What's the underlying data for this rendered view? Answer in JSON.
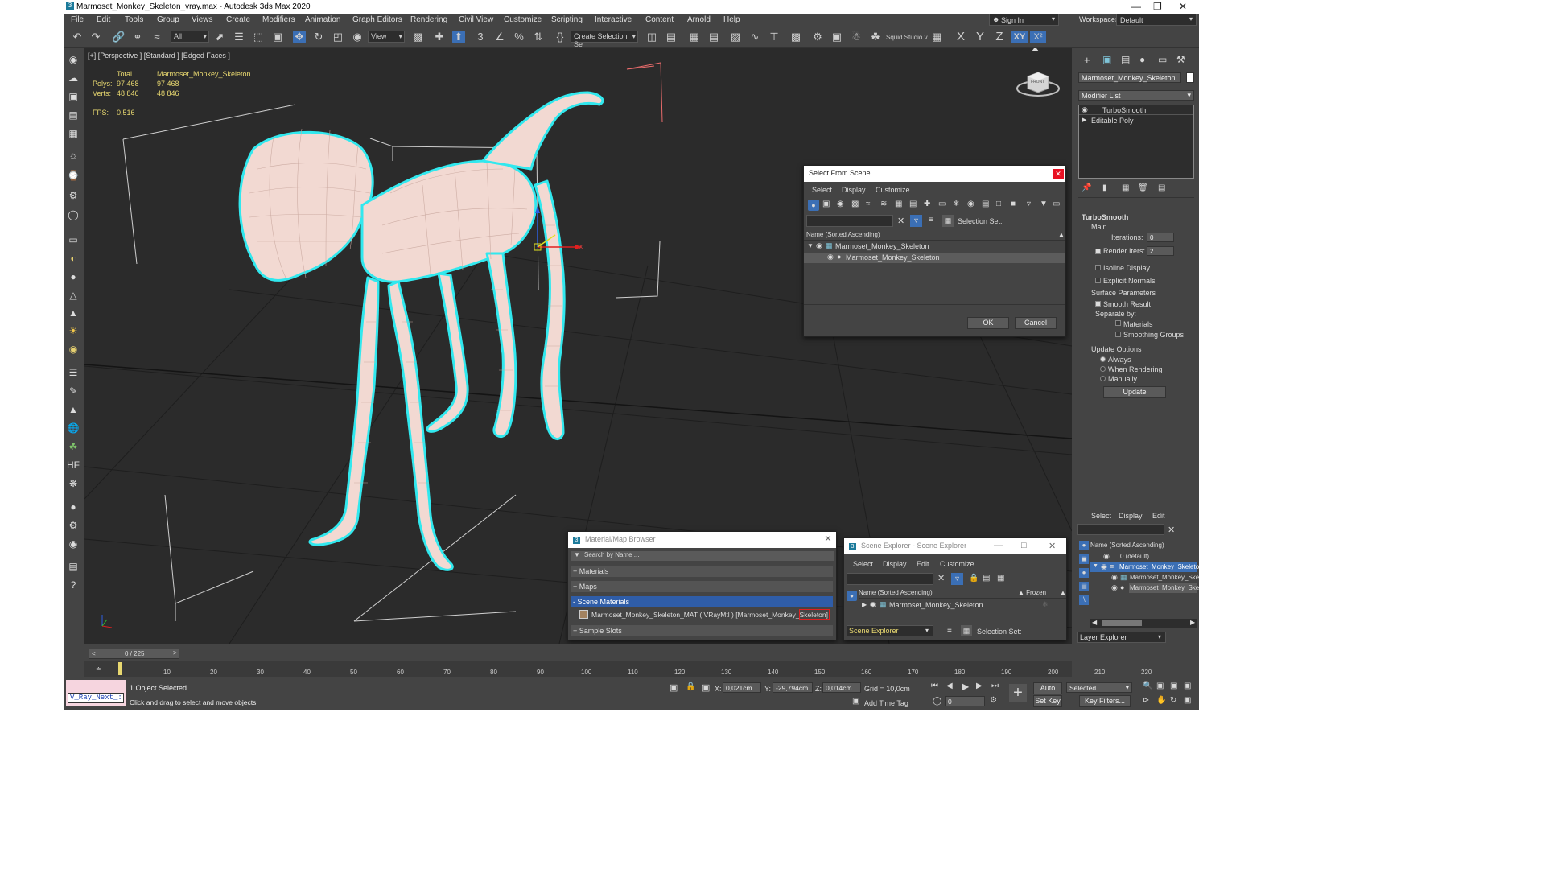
{
  "window": {
    "title": "Marmoset_Monkey_Skeleton_vray.max - Autodesk 3ds Max 2020"
  },
  "menu": [
    "File",
    "Edit",
    "Tools",
    "Group",
    "Views",
    "Create",
    "Modifiers",
    "Animation",
    "Graph Editors",
    "Rendering",
    "Civil View",
    "Customize",
    "Scripting",
    "Interactive",
    "Content",
    "Arnold",
    "Help"
  ],
  "account": {
    "signin": "Sign In",
    "workspaces_label": "Workspaces:",
    "workspace": "Default"
  },
  "toolbar": {
    "filter": "All",
    "refcoord": "View",
    "named_sel": "Create Selection Se",
    "squid": "Squid Studio v",
    "axes": [
      "X",
      "Y",
      "Z",
      "XY",
      "X²"
    ]
  },
  "viewport": {
    "label": "[+] [Perspective ] [Standard ] [Edged Faces ]",
    "stats": {
      "total": "Total",
      "object": "Marmoset_Monkey_Skeleton",
      "polys_label": "Polys:",
      "polys_total": "97 468",
      "polys_obj": "97 468",
      "verts_label": "Verts:",
      "verts_total": "48 846",
      "verts_obj": "48 846",
      "fps_label": "FPS:",
      "fps": "0,516"
    },
    "gizmo_x": "x",
    "viewcube": "FRONT"
  },
  "command_panel": {
    "object_name": "Marmoset_Monkey_Skeleton",
    "modifier_list": "Modifier List",
    "stack": [
      "TurboSmooth",
      "Editable Poly"
    ],
    "rollout": "TurboSmooth",
    "main": "Main",
    "iterations_label": "Iterations:",
    "iterations": "0",
    "render_iters_label": "Render Iters:",
    "render_iters": "2",
    "isoline": "Isoline Display",
    "explicit": "Explicit Normals",
    "surface": "Surface Parameters",
    "smooth_result": "Smooth Result",
    "separate_by": "Separate by:",
    "materials": "Materials",
    "smoothing_groups": "Smoothing Groups",
    "update_options": "Update Options",
    "always": "Always",
    "when_rendering": "When Rendering",
    "manually": "Manually",
    "update": "Update"
  },
  "select_from_scene": {
    "title": "Select From Scene",
    "menu": [
      "Select",
      "Display",
      "Customize"
    ],
    "selection_set": "Selection Set:",
    "col": "Name (Sorted Ascending)",
    "items": [
      "Marmoset_Monkey_Skeleton",
      "Marmoset_Monkey_Skeleton"
    ],
    "ok": "OK",
    "cancel": "Cancel"
  },
  "material_browser": {
    "title": "Material/Map Browser",
    "search": "Search by Name ...",
    "groups": [
      "+ Materials",
      "+ Maps",
      "- Scene Materials",
      "+ Sample Slots"
    ],
    "material": "Marmoset_Monkey_Skeleton_MAT ( VRayMtl ) [Marmoset_Monkey_Skeleton]"
  },
  "scene_explorer": {
    "title": "Scene Explorer - Scene Explorer",
    "menu": [
      "Select",
      "Display",
      "Edit",
      "Customize"
    ],
    "col": "Name (Sorted Ascending)",
    "frozen": "▲ Frozen",
    "item": "Marmoset_Monkey_Skeleton",
    "footer": "Scene Explorer",
    "selection_set": "Selection Set:"
  },
  "layer_panel": {
    "menu": [
      "Select",
      "Display",
      "Edit"
    ],
    "col": "Name (Sorted Ascending)",
    "items": [
      "0 (default)",
      "Marmoset_Monkey_Skeleto",
      "Marmoset_Monkey_Ske",
      "Marmoset_Monkey_Ske"
    ],
    "footer": "Layer Explorer"
  },
  "timeline": {
    "frame": "0 / 225",
    "ticks": [
      "10",
      "20",
      "30",
      "40",
      "50",
      "60",
      "70",
      "80",
      "90",
      "100",
      "110",
      "120",
      "130",
      "140",
      "150",
      "160",
      "170",
      "180",
      "190",
      "200",
      "210",
      "220"
    ]
  },
  "status": {
    "script": "V_Ray_Next_:",
    "selected": "1 Object Selected",
    "prompt": "Click and drag to select and move objects",
    "x_label": "X:",
    "x": "0,021cm",
    "y_label": "Y:",
    "y": "-29,794cm",
    "z_label": "Z:",
    "z": "0,014cm",
    "grid": "Grid = 10,0cm",
    "add_time_tag": "Add Time Tag",
    "auto_key": "Auto Key",
    "set_key": "Set Key",
    "key_mode": "Selected",
    "key_filters": "Key Filters...",
    "frame_field": "0"
  },
  "colors": {
    "wire": "#f2d9d2",
    "highlight": "#31e8ee",
    "accent": "#3b6fb5"
  }
}
